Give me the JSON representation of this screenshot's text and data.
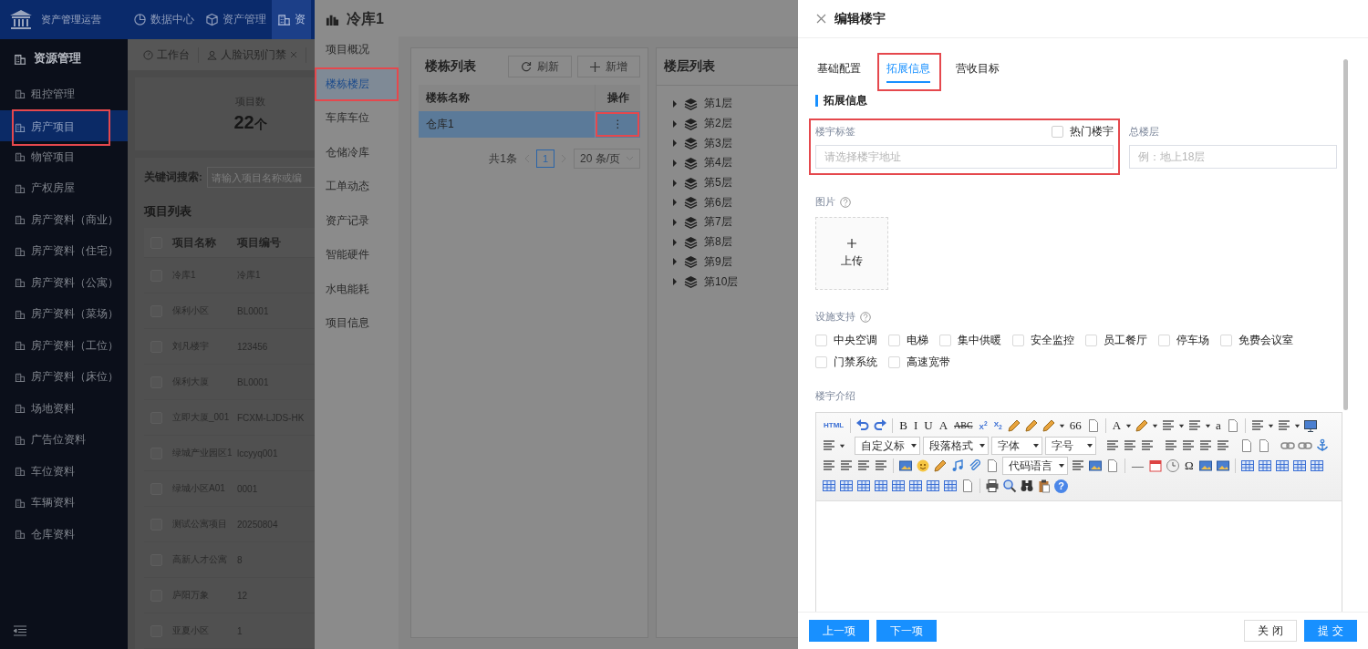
{
  "app": {
    "title": "资产管理运营",
    "nav": [
      {
        "label": "数据中心",
        "selected": false
      },
      {
        "label": "资产管理",
        "selected": false
      },
      {
        "label": "资",
        "selected": true
      }
    ]
  },
  "sidebar": {
    "heading": "资源管理",
    "items": [
      {
        "label": "租控管理",
        "selected": false,
        "highlighted": false
      },
      {
        "label": "房产项目",
        "selected": true,
        "highlighted": true
      },
      {
        "label": "物管项目",
        "selected": false,
        "highlighted": false
      },
      {
        "label": "产权房屋",
        "selected": false,
        "highlighted": false
      },
      {
        "label": "房产资料（商业）",
        "selected": false,
        "highlighted": false
      },
      {
        "label": "房产资料（住宅）",
        "selected": false,
        "highlighted": false
      },
      {
        "label": "房产资料（公寓）",
        "selected": false,
        "highlighted": false
      },
      {
        "label": "房产资料（菜场）",
        "selected": false,
        "highlighted": false
      },
      {
        "label": "房产资料（工位）",
        "selected": false,
        "highlighted": false
      },
      {
        "label": "房产资料（床位）",
        "selected": false,
        "highlighted": false
      },
      {
        "label": "场地资料",
        "selected": false,
        "highlighted": false
      },
      {
        "label": "广告位资料",
        "selected": false,
        "highlighted": false
      },
      {
        "label": "车位资料",
        "selected": false,
        "highlighted": false
      },
      {
        "label": "车辆资料",
        "selected": false,
        "highlighted": false
      },
      {
        "label": "仓库资料",
        "selected": false,
        "highlighted": false
      }
    ]
  },
  "page_tabs": [
    {
      "label": "工作台",
      "closable": false
    },
    {
      "label": "人脸识别门禁",
      "closable": true
    }
  ],
  "stats": {
    "label": "项目数",
    "value": "22",
    "unit": "个"
  },
  "search": {
    "label": "关键词搜索:",
    "placeholder": "请输入项目名称或编"
  },
  "project_list": {
    "title": "项目列表",
    "all_checked": false,
    "columns": [
      "项目名称",
      "项目编号"
    ],
    "rows": [
      {
        "checked": false,
        "cells": [
          "冷库1",
          "冷库1"
        ]
      },
      {
        "checked": false,
        "cells": [
          "保利小区",
          "BL0001"
        ]
      },
      {
        "checked": false,
        "cells": [
          "刘凡楼宇",
          "123456"
        ]
      },
      {
        "checked": false,
        "cells": [
          "保利大厦",
          "BL0001"
        ]
      },
      {
        "checked": false,
        "cells": [
          "立即大厦_001",
          "FCXM-LJDS-HK"
        ]
      },
      {
        "checked": false,
        "cells": [
          "绿城产业园区1",
          "lccyyq001"
        ]
      },
      {
        "checked": false,
        "cells": [
          "绿城小区A01",
          "0001"
        ]
      },
      {
        "checked": false,
        "cells": [
          "测试公寓项目",
          "20250804"
        ]
      },
      {
        "checked": false,
        "cells": [
          "高新人才公寓",
          "8"
        ]
      },
      {
        "checked": false,
        "cells": [
          "庐阳万象",
          "12"
        ]
      },
      {
        "checked": false,
        "cells": [
          "亚夏小区",
          "1"
        ]
      }
    ]
  },
  "project_drawer": {
    "title": "冷库1",
    "nav": [
      {
        "label": "项目概况",
        "selected": false,
        "highlighted": false
      },
      {
        "label": "楼栋楼层",
        "selected": true,
        "highlighted": true
      },
      {
        "label": "车库车位",
        "selected": false,
        "highlighted": false
      },
      {
        "label": "仓储冷库",
        "selected": false,
        "highlighted": false
      },
      {
        "label": "工单动态",
        "selected": false,
        "highlighted": false
      },
      {
        "label": "资产记录",
        "selected": false,
        "highlighted": false
      },
      {
        "label": "智能硬件",
        "selected": false,
        "highlighted": false
      },
      {
        "label": "水电能耗",
        "selected": false,
        "highlighted": false
      },
      {
        "label": "项目信息",
        "selected": false,
        "highlighted": false
      }
    ],
    "building_list": {
      "title": "楼栋列表",
      "buttons": [
        {
          "kind": "refresh",
          "label": "刷新"
        },
        {
          "kind": "add",
          "label": "新增"
        }
      ],
      "columns": [
        "楼栋名称",
        "操作"
      ],
      "rows": [
        {
          "name": "仓库1",
          "action": "⋮",
          "selected": true,
          "highlighted": true
        }
      ],
      "pagination": {
        "total": "共1条",
        "pages": [
          {
            "label": "1",
            "selected": true
          }
        ],
        "page_size": "20 条/页"
      }
    },
    "floor_list": {
      "title": "楼层列表",
      "floors": [
        {
          "label": "第1层",
          "expanded": false
        },
        {
          "label": "第2层",
          "expanded": false
        },
        {
          "label": "第3层",
          "expanded": false
        },
        {
          "label": "第4层",
          "expanded": false
        },
        {
          "label": "第5层",
          "expanded": false
        },
        {
          "label": "第6层",
          "expanded": false
        },
        {
          "label": "第7层",
          "expanded": false
        },
        {
          "label": "第8层",
          "expanded": false
        },
        {
          "label": "第9层",
          "expanded": false
        },
        {
          "label": "第10层",
          "expanded": false
        }
      ]
    }
  },
  "edit_drawer": {
    "title": "编辑楼宇",
    "tabs": [
      {
        "label": "基础配置",
        "selected": false,
        "highlighted": false
      },
      {
        "label": "拓展信息",
        "selected": true,
        "highlighted": true
      },
      {
        "label": "营收目标",
        "selected": false,
        "highlighted": false
      }
    ],
    "section_title": "拓展信息",
    "tag_field": {
      "label": "楼宇标签",
      "placeholder": "请选择楼宇地址",
      "highlighted": true
    },
    "hot": {
      "label": "热门楼宇",
      "checked": false
    },
    "floors_field": {
      "label": "总楼层",
      "placeholder": "例：地上18层"
    },
    "image": {
      "label": "图片",
      "upload_label": "上传"
    },
    "facilities": {
      "label": "设施支持",
      "options": [
        {
          "label": "中央空调",
          "checked": false
        },
        {
          "label": "电梯",
          "checked": false
        },
        {
          "label": "集中供暖",
          "checked": false
        },
        {
          "label": "安全监控",
          "checked": false
        },
        {
          "label": "员工餐厅",
          "checked": false
        },
        {
          "label": "停车场",
          "checked": false
        },
        {
          "label": "免费会议室",
          "checked": false
        },
        {
          "label": "门禁系统",
          "checked": false
        },
        {
          "label": "高速宽带",
          "checked": false
        }
      ]
    },
    "intro": {
      "label": "楼宇介绍",
      "toolbar": [
        [
          {
            "kind": "text",
            "text": "HTML"
          },
          {
            "kind": "sep"
          },
          {
            "kind": "undo"
          },
          {
            "kind": "redo"
          },
          {
            "kind": "sep"
          },
          {
            "kind": "text",
            "text": "B"
          },
          {
            "kind": "text",
            "text": "I"
          },
          {
            "kind": "text",
            "text": "U"
          },
          {
            "kind": "text",
            "text": "A"
          },
          {
            "kind": "strike",
            "text": "ABC"
          },
          {
            "kind": "text",
            "text": "X$^{2}$"
          },
          {
            "kind": "text",
            "text": "X$_{2}$"
          },
          {
            "kind": "pen"
          },
          {
            "kind": "pen"
          },
          {
            "kind": "pen",
            "dropdown": true
          },
          {
            "kind": "text",
            "text": "66"
          },
          {
            "kind": "page"
          },
          {
            "kind": "sep"
          },
          {
            "kind": "text",
            "text": "A",
            "dropdown": true
          },
          {
            "kind": "pen",
            "dropdown": true
          },
          {
            "kind": "lines",
            "dropdown": true
          },
          {
            "kind": "lines",
            "dropdown": true
          },
          {
            "kind": "text",
            "text": "a"
          },
          {
            "kind": "page"
          },
          {
            "kind": "sep"
          },
          {
            "kind": "lines",
            "dropdown": true
          },
          {
            "kind": "lines",
            "dropdown": true
          },
          {
            "kind": "monitor"
          }
        ],
        [
          {
            "kind": "lines",
            "dropdown": true
          },
          {
            "kind": "sep"
          },
          {
            "kind": "select",
            "text": "自定义标"
          },
          {
            "kind": "select",
            "text": "段落格式"
          },
          {
            "kind": "select",
            "text": "字体"
          },
          {
            "kind": "select",
            "text": "字号"
          },
          {
            "kind": "sep"
          },
          {
            "kind": "lines"
          },
          {
            "kind": "lines"
          },
          {
            "kind": "lines"
          },
          {
            "kind": "sep"
          },
          {
            "kind": "lines"
          },
          {
            "kind": "lines"
          },
          {
            "kind": "lines"
          },
          {
            "kind": "lines"
          },
          {
            "kind": "sep"
          },
          {
            "kind": "page"
          },
          {
            "kind": "page"
          },
          {
            "kind": "sep"
          },
          {
            "kind": "link"
          },
          {
            "kind": "link"
          },
          {
            "kind": "anchor"
          },
          {
            "kind": "sep"
          }
        ],
        [
          {
            "kind": "lines"
          },
          {
            "kind": "lines"
          },
          {
            "kind": "lines"
          },
          {
            "kind": "lines"
          },
          {
            "kind": "sep"
          },
          {
            "kind": "picture"
          },
          {
            "kind": "smiley"
          },
          {
            "kind": "pen"
          },
          {
            "kind": "music"
          },
          {
            "kind": "clip"
          },
          {
            "kind": "page"
          },
          {
            "kind": "select",
            "text": "代码语言"
          },
          {
            "kind": "lines"
          },
          {
            "kind": "picture"
          },
          {
            "kind": "page"
          },
          {
            "kind": "sep"
          },
          {
            "kind": "text",
            "text": "—"
          },
          {
            "kind": "calendar"
          },
          {
            "kind": "clock"
          },
          {
            "kind": "text",
            "text": "Ω"
          },
          {
            "kind": "picture"
          },
          {
            "kind": "picture"
          },
          {
            "kind": "sep"
          },
          {
            "kind": "grid"
          },
          {
            "kind": "grid"
          },
          {
            "kind": "grid"
          },
          {
            "kind": "grid"
          },
          {
            "kind": "grid"
          }
        ],
        [
          {
            "kind": "grid"
          },
          {
            "kind": "grid"
          },
          {
            "kind": "grid"
          },
          {
            "kind": "grid"
          },
          {
            "kind": "grid"
          },
          {
            "kind": "grid"
          },
          {
            "kind": "grid"
          },
          {
            "kind": "grid"
          },
          {
            "kind": "page"
          },
          {
            "kind": "sep"
          },
          {
            "kind": "printer"
          },
          {
            "kind": "search"
          },
          {
            "kind": "binoculars"
          },
          {
            "kind": "clipboard"
          },
          {
            "kind": "badge",
            "text": "?"
          }
        ]
      ]
    },
    "footer": {
      "nav_buttons": [
        "上一项",
        "下一项"
      ],
      "close": "关闭",
      "submit": "提交"
    }
  }
}
